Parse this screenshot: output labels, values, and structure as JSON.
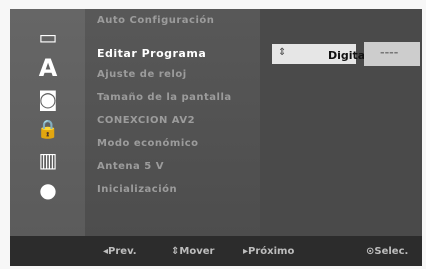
{
  "sidebar": {
    "icons": [
      {
        "name": "tv-icon",
        "glyph": "▭"
      },
      {
        "name": "language-icon",
        "glyph": "A"
      },
      {
        "name": "audio-icon",
        "glyph": "◙"
      },
      {
        "name": "lock-icon",
        "glyph": "🔒"
      },
      {
        "name": "film-icon",
        "glyph": "▥"
      },
      {
        "name": "disc-icon",
        "glyph": "●"
      }
    ]
  },
  "menu": {
    "items": [
      "Auto Configuración",
      "Editar Programa",
      "Ajuste de reloj",
      "Tamaño de la pantalla",
      "CONEXCION AV2",
      "Modo económico",
      "Antena 5 V",
      "Inicialización"
    ]
  },
  "option": {
    "arrows": "⇕",
    "value": "Digital",
    "secondary": "----"
  },
  "footer": {
    "prev": "◂Prev.",
    "move": "⇕Mover",
    "next": "▸Próximo",
    "select": "⊙Selec."
  }
}
